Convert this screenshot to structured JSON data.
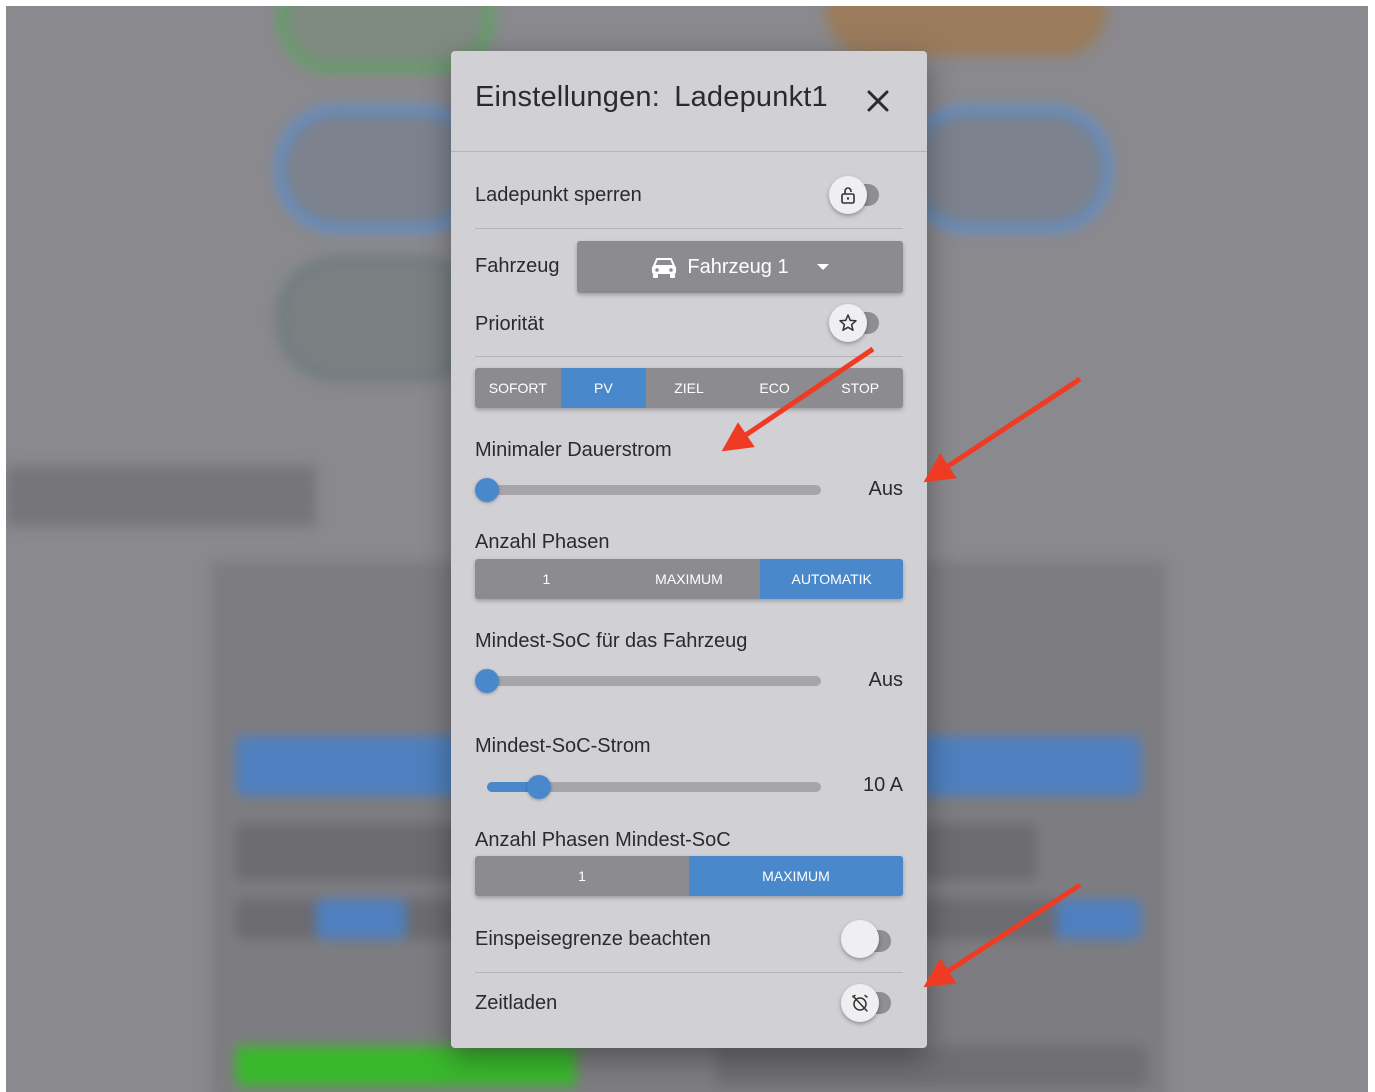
{
  "dialog": {
    "title_prefix": "Einstellungen:",
    "title_name": "Ladepunkt1",
    "lock": {
      "label": "Ladepunkt sperren",
      "icon": "lock-open-icon",
      "enabled": false
    },
    "vehicle": {
      "label": "Fahrzeug",
      "selected": "Fahrzeug 1",
      "icon": "car-icon"
    },
    "priority": {
      "label": "Priorität",
      "icon": "star-icon",
      "enabled": false
    },
    "modes": {
      "options": [
        "SOFORT",
        "PV",
        "ZIEL",
        "ECO",
        "STOP"
      ],
      "selected": "PV"
    },
    "min_current": {
      "label": "Minimaler Dauerstrom",
      "value": "Aus",
      "fraction": 0
    },
    "phases": {
      "label": "Anzahl Phasen",
      "options": [
        "1",
        "MAXIMUM",
        "AUTOMATIK"
      ],
      "selected": "AUTOMATIK"
    },
    "min_soc": {
      "label": "Mindest-SoC für das Fahrzeug",
      "value": "Aus",
      "fraction": 0
    },
    "min_soc_current": {
      "label": "Mindest-SoC-Strom",
      "value": "10 A",
      "fraction": 0.16
    },
    "min_soc_phases": {
      "label": "Anzahl Phasen Mindest-SoC",
      "options": [
        "1",
        "MAXIMUM"
      ],
      "selected": "MAXIMUM"
    },
    "feed_limit": {
      "label": "Einspeisegrenze beachten",
      "enabled": false
    },
    "timed": {
      "label": "Zeitladen",
      "icon": "alarm-off-icon",
      "enabled": false
    }
  },
  "colors": {
    "accent": "#4a88cc",
    "annotation_arrow": "#f03b24",
    "dialog_bg": "#d1d0d5"
  }
}
